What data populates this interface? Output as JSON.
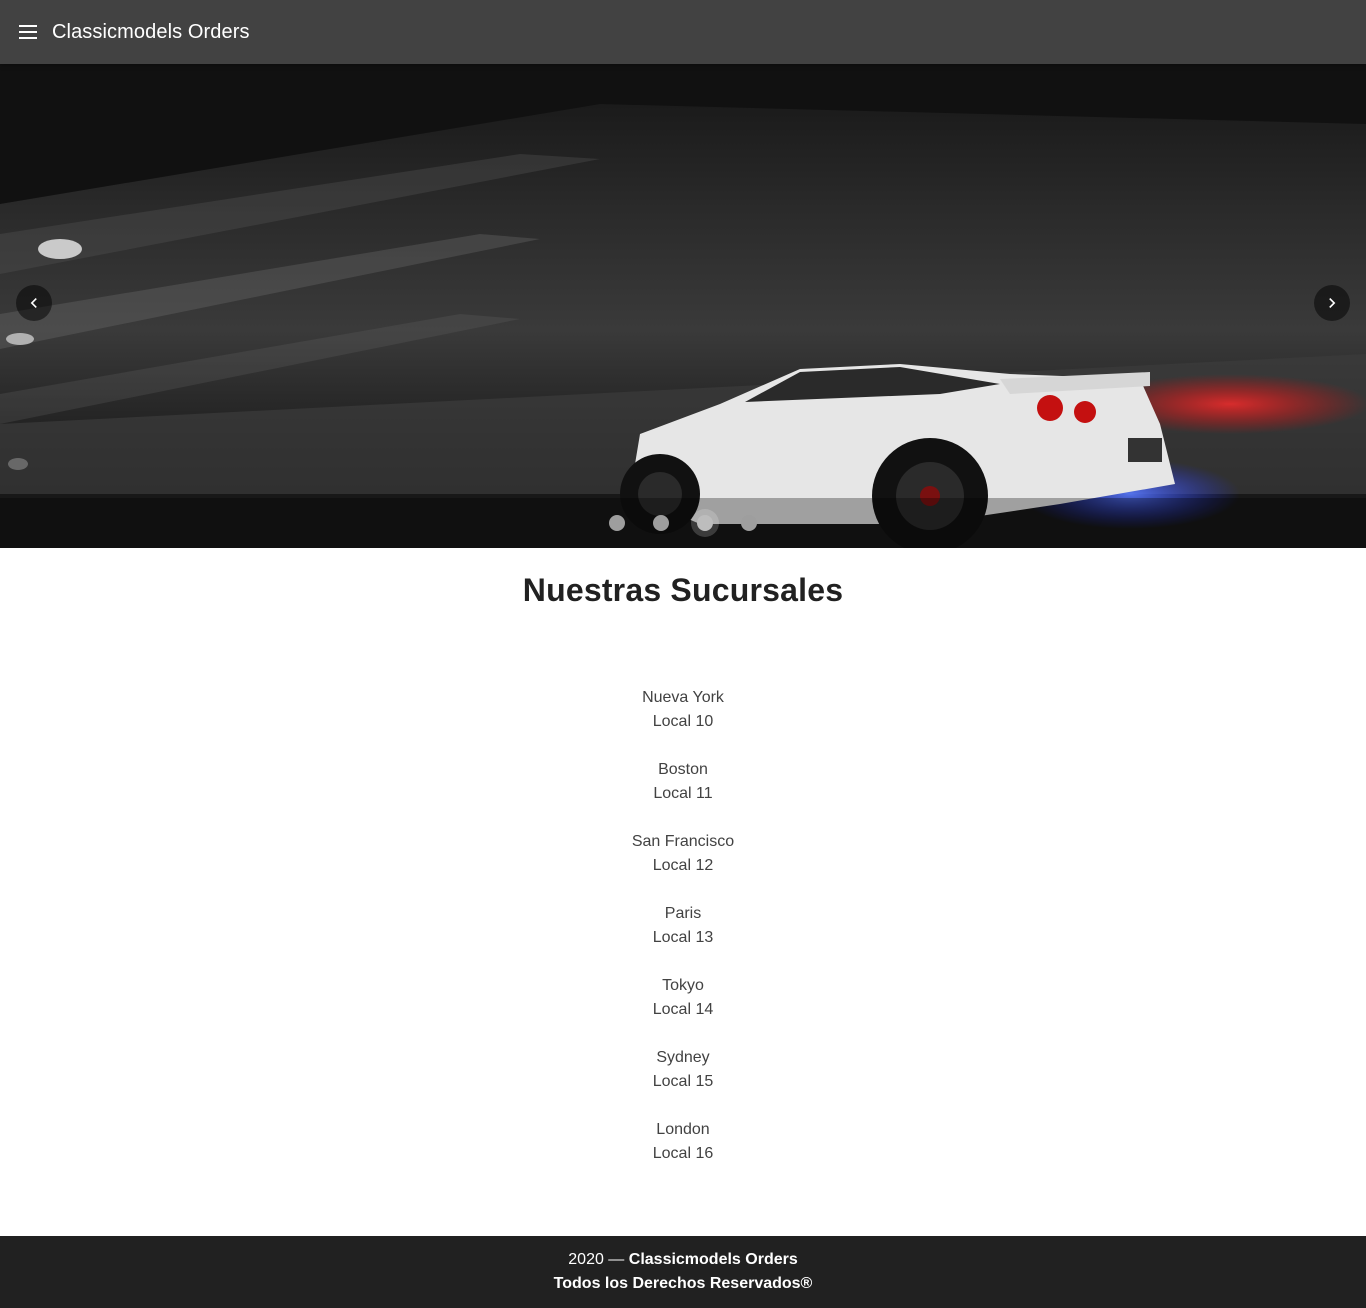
{
  "header": {
    "menu_icon": "hamburger-menu-icon",
    "title": "Classicmodels Orders"
  },
  "carousel": {
    "prev_icon": "chevron-left-icon",
    "next_icon": "chevron-right-icon",
    "slide_count": 4,
    "active_slide": 3
  },
  "main": {
    "title": "Nuestras Sucursales",
    "branches": [
      {
        "city": "Nueva York",
        "local": "Local 10"
      },
      {
        "city": "Boston",
        "local": "Local 11"
      },
      {
        "city": "San Francisco",
        "local": "Local 12"
      },
      {
        "city": "Paris",
        "local": "Local 13"
      },
      {
        "city": "Tokyo",
        "local": "Local 14"
      },
      {
        "city": "Sydney",
        "local": "Local 15"
      },
      {
        "city": "London",
        "local": "Local 16"
      }
    ]
  },
  "footer": {
    "year": "2020 —",
    "brand": "Classicmodels Orders",
    "rights": "Todos los Derechos Reservados®"
  },
  "colors": {
    "app_bar": "#424242",
    "footer": "#212121",
    "text": "#212121"
  }
}
